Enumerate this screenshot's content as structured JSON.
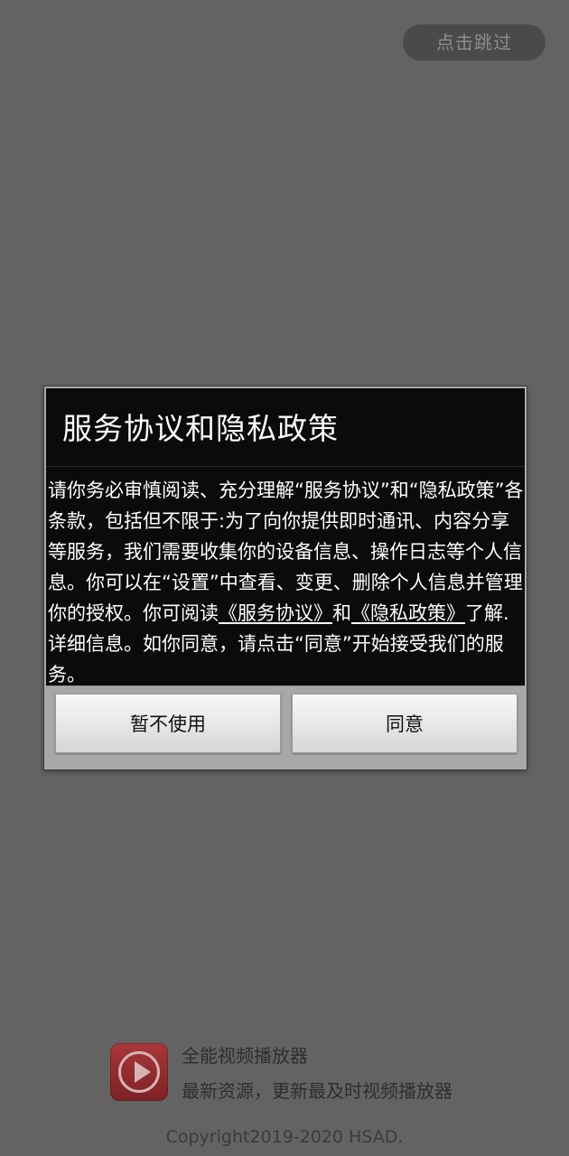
{
  "splash": {
    "skip_label": "点击跳过"
  },
  "dialog": {
    "title": "服务协议和隐私政策",
    "body": {
      "part1": "请你务必审慎阅读、充分理解“服务协议”和“隐私政策”各条款，包括但不限于:为了向你提供即时通讯、内容分享等服务，我们需要收集你的设备信息、操作日志等个人信息。你可以在“设置”中查看、变更、删除个人信息并管理你的授权。你可阅读",
      "link_service": "《服务协议》",
      "and": "和",
      "link_privacy": "《隐私政策》",
      "part2": "了解.详细信息。如你同意，请点击“同意”开始接受我们的服务。"
    },
    "buttons": {
      "decline": "暂不使用",
      "agree": "同意"
    }
  },
  "app": {
    "icon": "play-icon",
    "name": "全能视频播放器",
    "tagline": "最新资源，更新最及时视频播放器",
    "copyright": "Copyright2019-2020 HSAD."
  }
}
